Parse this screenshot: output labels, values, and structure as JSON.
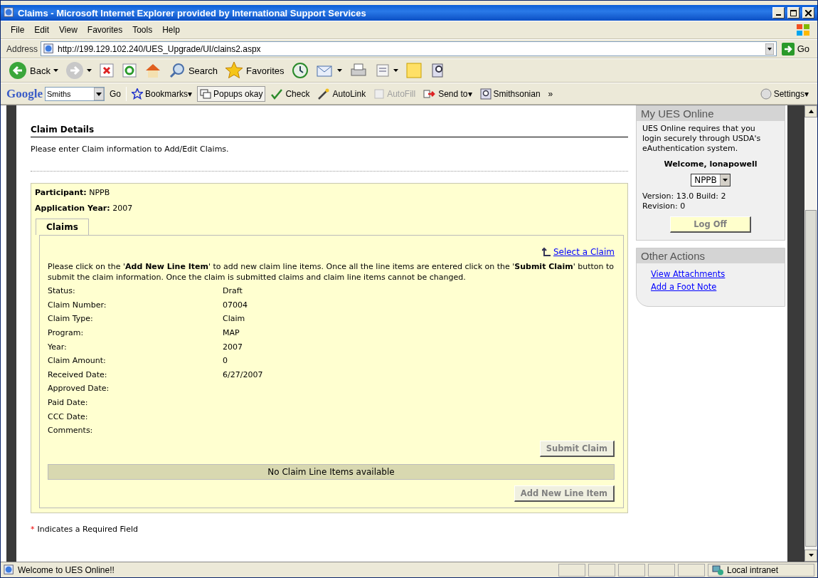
{
  "window": {
    "title": "Claims - Microsoft Internet Explorer provided by International Support Services"
  },
  "menu": [
    "File",
    "Edit",
    "View",
    "Favorites",
    "Tools",
    "Help"
  ],
  "address": {
    "label": "Address",
    "url": "http://199.129.102.240/UES_Upgrade/UI/clains2.aspx",
    "go": "Go"
  },
  "toolbar": [
    {
      "kind": "back",
      "label": "Back"
    },
    {
      "kind": "forward"
    },
    {
      "kind": "stop"
    },
    {
      "kind": "refresh"
    },
    {
      "kind": "home"
    },
    {
      "kind": "search",
      "label": "Search"
    },
    {
      "kind": "favorites",
      "label": "Favorites"
    },
    {
      "kind": "history"
    },
    {
      "kind": "mail"
    },
    {
      "kind": "print"
    },
    {
      "kind": "edit"
    },
    {
      "kind": "note"
    },
    {
      "kind": "research"
    }
  ],
  "google_bar": {
    "logo": "Google",
    "search_value": "Smiths",
    "go": "Go",
    "items": [
      {
        "label": "Bookmarks▾",
        "disabled": false
      },
      {
        "label": "Popups okay",
        "disabled": false
      },
      {
        "label": "Check",
        "disabled": false
      },
      {
        "label": "AutoLink",
        "disabled": false
      },
      {
        "label": "AutoFill",
        "disabled": true
      },
      {
        "label": "Send to▾",
        "disabled": false
      },
      {
        "label": "Smithsonian",
        "disabled": false
      }
    ],
    "more": "»",
    "settings": "Settings▾"
  },
  "page": {
    "title": "Claim Details",
    "intro": "Please enter Claim information to Add/Edit Claims.",
    "participant": {
      "label": "Participant:",
      "value": "NPPB"
    },
    "application_year": {
      "label": "Application Year:",
      "value": "2007"
    },
    "tabs": [
      {
        "label": "Claims",
        "selected": true
      }
    ],
    "select_link": "Select a Claim",
    "instructions": "Please click on the '**Add New Line Item**' to add new claim line items. Once all the line items are entered click on the '**Submit Claim**' button to submit the claim information. Once the claim is submitted claims and claim line items cannot be changed.",
    "fields": [
      {
        "label": "Status:",
        "value": "Draft"
      },
      {
        "label": "Claim Number:",
        "value": "07004"
      },
      {
        "label": "Claim Type:",
        "value": "Claim"
      },
      {
        "label": "Program:",
        "value": "MAP"
      },
      {
        "label": "Year:",
        "value": "2007"
      },
      {
        "label": "Claim Amount:",
        "value": "0"
      },
      {
        "label": "Received Date:",
        "value": "6/27/2007"
      },
      {
        "label": "Approved Date:"
      },
      {
        "label": "Paid Date:"
      },
      {
        "label": "CCC Date:"
      },
      {
        "label": "Comments:"
      }
    ],
    "submit_button": "Submit Claim",
    "empty_message": "No Claim Line Items available",
    "add_button": "Add New Line Item",
    "required_mark": "*",
    "required_note": "Indicates a Required Field"
  },
  "sidebar": {
    "my_ues": {
      "title": "My UES Online",
      "text": "UES Online requires that you login securely through USDA's eAuthentication system.",
      "welcome": "Welcome, lonapowell",
      "select_value": "NPPB",
      "version": "Version: 13.0 Build: 2 Revision: 0",
      "logoff": "Log Off"
    },
    "other_actions": {
      "title": "Other Actions",
      "links": [
        "View Attachments",
        "Add a Foot Note"
      ]
    }
  },
  "status_bar": {
    "text": "Welcome to UES Online!!",
    "zone": "Local intranet"
  }
}
